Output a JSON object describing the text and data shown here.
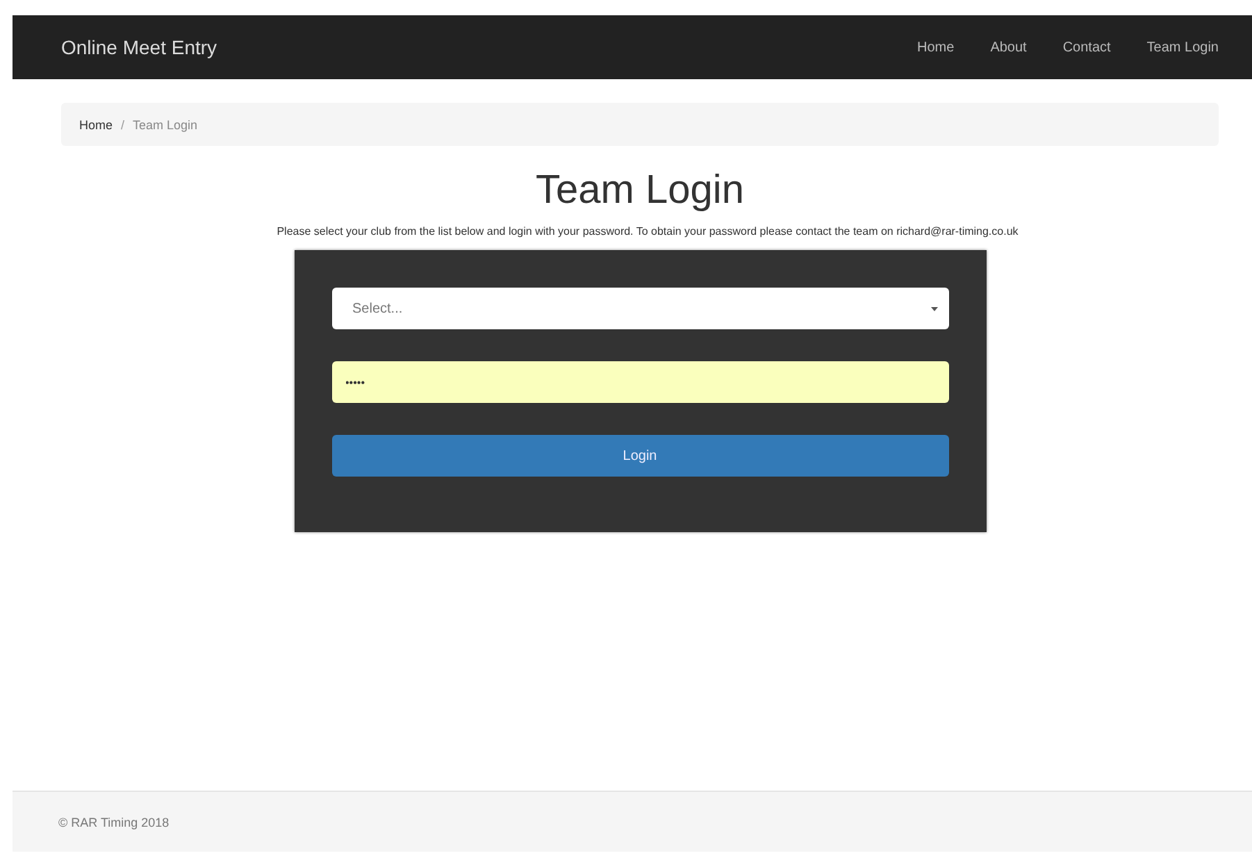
{
  "navbar": {
    "brand": "Online Meet Entry",
    "links": [
      {
        "label": "Home",
        "selected": false
      },
      {
        "label": "About",
        "selected": false
      },
      {
        "label": "Contact",
        "selected": false
      },
      {
        "label": "Team Login",
        "selected": false
      }
    ]
  },
  "breadcrumb": [
    {
      "label": "Home",
      "kind": "link"
    },
    {
      "label": "/",
      "kind": "separator"
    },
    {
      "label": "Team Login",
      "kind": "current"
    }
  ],
  "heading": "Team Login",
  "instructions": "Please select your club from the list below and login with your password. To obtain your password please contact the team on richard@rar-timing.co.uk",
  "login_form": {
    "club_select": {
      "placeholder": "Select..."
    },
    "password": {
      "value": "•••••",
      "autofilled": true
    },
    "button": "Login"
  },
  "footer": "© RAR Timing 2018"
}
